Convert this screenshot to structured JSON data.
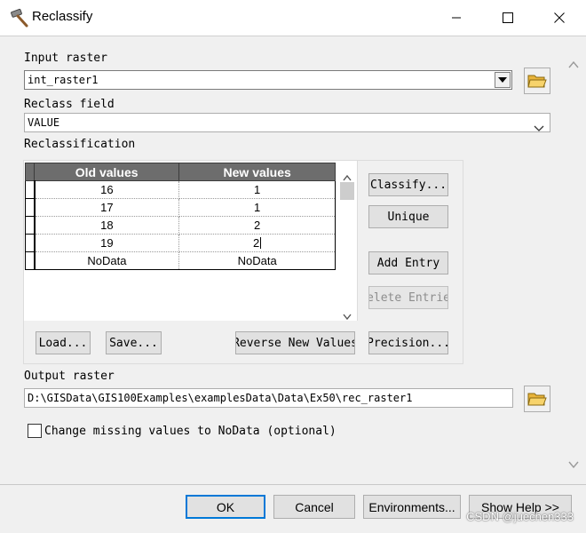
{
  "window": {
    "title": "Reclassify"
  },
  "input_raster": {
    "label": "Input raster",
    "value": "int_raster1"
  },
  "reclass_field": {
    "label": "Reclass field",
    "value": "VALUE"
  },
  "reclassification": {
    "label": "Reclassification",
    "headers": [
      "Old values",
      "New values"
    ],
    "rows": [
      {
        "old": "16",
        "new": "1"
      },
      {
        "old": "17",
        "new": "1"
      },
      {
        "old": "18",
        "new": "2"
      },
      {
        "old": "19",
        "new": "2"
      },
      {
        "old": "NoData",
        "new": "NoData"
      }
    ],
    "buttons": {
      "classify": "Classify...",
      "unique": "Unique",
      "add_entry": "Add Entry",
      "delete_entries": "elete Entrie",
      "load": "Load...",
      "save": "Save...",
      "reverse": "Reverse New Values",
      "precision": "Precision..."
    }
  },
  "output_raster": {
    "label": "Output raster",
    "value": "D:\\GISData\\GIS100Examples\\examplesData\\Data\\Ex50\\rec_raster1"
  },
  "change_missing": {
    "label": "Change missing values to NoData (optional)",
    "checked": false
  },
  "footer": {
    "ok": "OK",
    "cancel": "Cancel",
    "environments": "Environments...",
    "show_help": "Show Help >>"
  },
  "watermark": "CSDN @juechen333"
}
